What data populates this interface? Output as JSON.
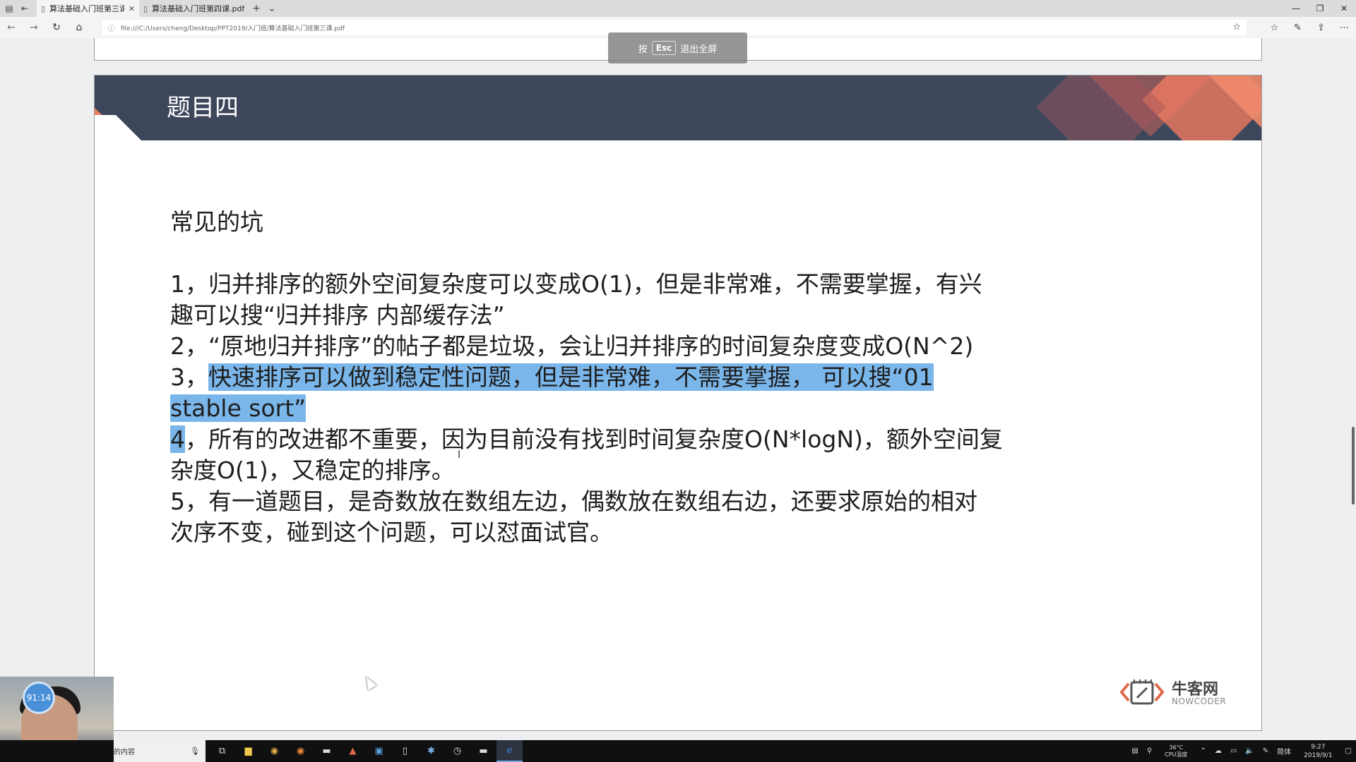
{
  "tabs": [
    {
      "label": "算法基础入门班第三课.pdf",
      "active": true
    },
    {
      "label": "算法基础入门班第四课.pdf",
      "active": false
    }
  ],
  "address": {
    "url": "file:///C:/Users/cheng/Desktop/PPT2019/入门班/算法基础入门班第三课.pdf"
  },
  "esc_hint": {
    "prefix": "按",
    "key": "Esc",
    "suffix": "退出全屏"
  },
  "slide": {
    "title": "题目四",
    "heading": "常见的坑",
    "item1_a": "1，归并排序的额外空间复杂度可以变成O(1)，但是非常难，不需要掌握，有兴",
    "item1_b": "趣可以搜“归并排序 内部缓存法”",
    "item2": "2，“原地归并排序”的帖子都是垃圾，会让归并排序的时间复杂度变成O(N^2)",
    "item3_prefix": "3，",
    "item3_hl_a": "快速排序可以做到稳定性问题，但是非常难，不需要掌握， 可以搜“01",
    "item3_hl_b": "stable sort”",
    "item4_hl": "4",
    "item4_a": "，所有的改进都不重要，因为目前没有找到时间复杂度O(N*logN)，额外空间复",
    "item4_b": "杂度O(1)，又稳定的排序。",
    "item5_a": "5，有一道题目，是奇数放在数组左边，偶数放在数组右边，还要求原始的相对",
    "item5_b": "次序不变，碰到这个问题，可以怼面试官。"
  },
  "logo": {
    "cn": "牛客网",
    "en": "NOWCODER"
  },
  "webcam": {
    "timer": "91:14"
  },
  "taskbar": {
    "search_text": "的内容",
    "cpu_temp": "36°C",
    "cpu_label": "CPU温度",
    "ime": "简体",
    "time": "9:27",
    "date": "2019/9/1"
  },
  "colors": {
    "header": "#3d475c",
    "accent": "#f08060",
    "highlight": "#7ab6ea"
  }
}
